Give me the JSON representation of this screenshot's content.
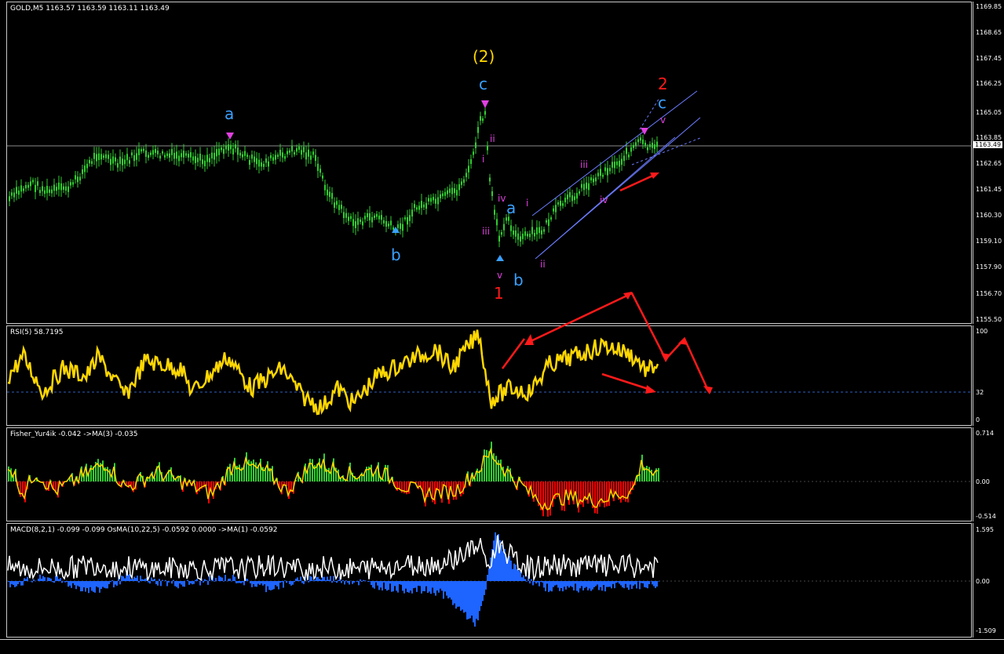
{
  "main": {
    "header": "GOLD,M5  1163.57 1163.59 1163.11 1163.49",
    "price_ticks": [
      "1169.85",
      "1168.65",
      "1167.45",
      "1166.25",
      "1165.05",
      "1163.85",
      "1162.65",
      "1161.45",
      "1160.30",
      "1159.10",
      "1157.90",
      "1156.70",
      "1155.50"
    ],
    "current_price": "1163.49",
    "wave_labels": {
      "w2": "(2)",
      "c1": "c",
      "a1": "a",
      "b1": "b",
      "one": "1",
      "a2": "a",
      "b2": "b",
      "two": "2",
      "c2": "c",
      "i": "i",
      "ii": "ii",
      "iii": "iii",
      "iv": "iv",
      "v": "v",
      "ii_small": "ii",
      "i_small": "i",
      "iii_small": "iii",
      "iv_small": "iv",
      "v_small": "v"
    }
  },
  "rsi": {
    "header": "RSI(5) 58.7195",
    "ticks": [
      "100",
      "32",
      "0"
    ]
  },
  "fisher": {
    "header": "Fisher_Yur4ik -0.042  ->MA(3) -0.035",
    "ticks": [
      "0.714",
      "0.00",
      "-0.514"
    ]
  },
  "macd": {
    "header": "MACD(8,2,1) -0.099 -0.099  OsMA(10,22,5) -0.0592 0.0000  ->MA(1) -0.0592",
    "ticks": [
      "1.595",
      "0.00",
      "-1.509"
    ]
  },
  "colors": {
    "candle": "#32cd32",
    "rsi_line": "#ffd700",
    "fisher_pos": "#32cd32",
    "fisher_neg": "#ff0000",
    "macd_hist": "#1e64ff",
    "annot_red": "#ff1a1a",
    "wave_blue": "#3aa0ff",
    "wave_magenta": "#e040e0",
    "wave_yellow": "#ffd700"
  }
}
